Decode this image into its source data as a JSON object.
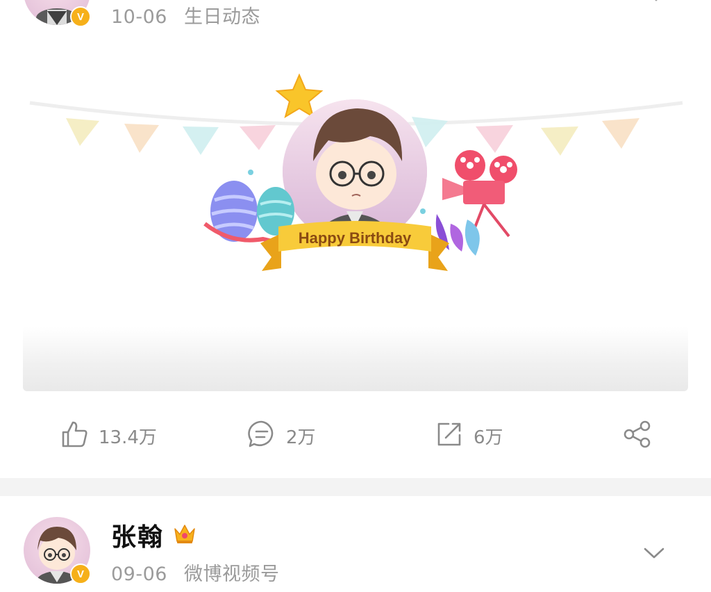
{
  "post_top": {
    "date": "10-06",
    "source": "生日动态",
    "avatar_badge": "V"
  },
  "birthday_card": {
    "banner_text": "Happy Birthday"
  },
  "actions": {
    "like_count": "13.4万",
    "comment_count": "2万",
    "repost_count": "6万"
  },
  "post_next": {
    "username": "张翰",
    "date": "09-06",
    "source": "微博视频号",
    "avatar_badge": "V"
  },
  "icons": {
    "like": "thumbs-up-icon",
    "comment": "comment-icon",
    "repost": "repost-icon",
    "share": "share-icon",
    "crown": "crown-icon",
    "chevron": "chevron-down-icon"
  }
}
